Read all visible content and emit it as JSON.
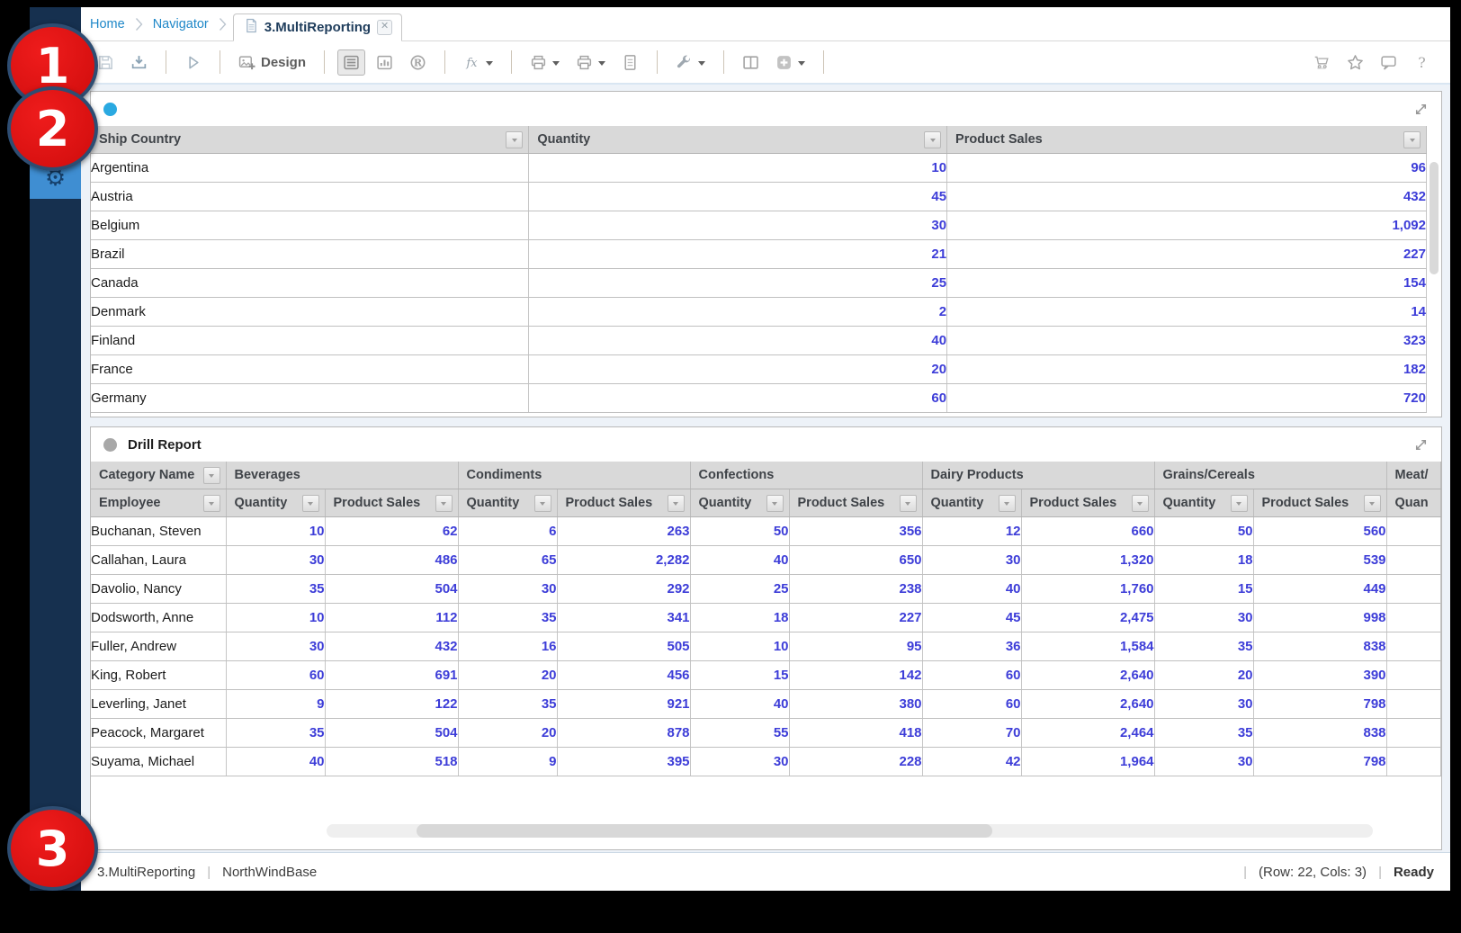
{
  "window": {
    "breadcrumbs": [
      "Home",
      "Navigator"
    ],
    "tab": {
      "label": "3.MultiReporting"
    }
  },
  "toolbar": {
    "left": [
      {
        "icon": "floppy",
        "name": "save",
        "disabled": true
      },
      {
        "icon": "export",
        "name": "export"
      },
      {
        "sep": true
      },
      {
        "icon": "run",
        "name": "run"
      },
      {
        "sep": true
      },
      {
        "icon": "design",
        "name": "design",
        "label": "Design"
      },
      {
        "sep": true
      },
      {
        "icon": "parameters",
        "name": "parameters-panel",
        "selected": true
      },
      {
        "icon": "chart",
        "name": "chart-view"
      },
      {
        "icon": "r-viewer",
        "name": "report-viewer"
      },
      {
        "sep": true
      },
      {
        "icon": "fx",
        "name": "functions",
        "caret": true
      },
      {
        "sep": true
      },
      {
        "icon": "print",
        "name": "print",
        "caret": true
      },
      {
        "icon": "print",
        "name": "print-export",
        "caret": true
      },
      {
        "icon": "page",
        "name": "page-setup"
      },
      {
        "sep": true
      },
      {
        "icon": "wrench",
        "name": "tools",
        "caret": true
      },
      {
        "sep": true
      },
      {
        "icon": "columns",
        "name": "split-view"
      },
      {
        "icon": "add",
        "name": "add-panel",
        "caret": true
      },
      {
        "sep": true
      }
    ],
    "right": [
      {
        "icon": "cart",
        "name": "cart"
      },
      {
        "icon": "star",
        "name": "favorites"
      },
      {
        "icon": "comment",
        "name": "feedback"
      },
      {
        "icon": "help",
        "name": "help"
      }
    ]
  },
  "panel1": {
    "columns": [
      "Ship Country",
      "Quantity",
      "Product Sales"
    ],
    "rows": [
      [
        "Argentina",
        "10",
        "96"
      ],
      [
        "Austria",
        "45",
        "432"
      ],
      [
        "Belgium",
        "30",
        "1,092"
      ],
      [
        "Brazil",
        "21",
        "227"
      ],
      [
        "Canada",
        "25",
        "154"
      ],
      [
        "Denmark",
        "2",
        "14"
      ],
      [
        "Finland",
        "40",
        "323"
      ],
      [
        "France",
        "20",
        "182"
      ],
      [
        "Germany",
        "60",
        "720"
      ]
    ]
  },
  "panel2": {
    "title": "Drill Report",
    "corner_header": "Category Name",
    "row_header": "Employee",
    "categories": [
      "Beverages",
      "Condiments",
      "Confections",
      "Dairy Products",
      "Grains/Cereals",
      "Meat/"
    ],
    "subcolumns": [
      "Quantity",
      "Product Sales"
    ],
    "truncated_subcolumn": "Quan",
    "rows": [
      {
        "employee": "Buchanan, Steven",
        "values": [
          "10",
          "62",
          "6",
          "263",
          "50",
          "356",
          "12",
          "660",
          "50",
          "560"
        ]
      },
      {
        "employee": "Callahan, Laura",
        "values": [
          "30",
          "486",
          "65",
          "2,282",
          "40",
          "650",
          "30",
          "1,320",
          "18",
          "539"
        ]
      },
      {
        "employee": "Davolio, Nancy",
        "values": [
          "35",
          "504",
          "30",
          "292",
          "25",
          "238",
          "40",
          "1,760",
          "15",
          "449"
        ]
      },
      {
        "employee": "Dodsworth, Anne",
        "values": [
          "10",
          "112",
          "35",
          "341",
          "18",
          "227",
          "45",
          "2,475",
          "30",
          "998"
        ]
      },
      {
        "employee": "Fuller, Andrew",
        "values": [
          "30",
          "432",
          "16",
          "505",
          "10",
          "95",
          "36",
          "1,584",
          "35",
          "838"
        ]
      },
      {
        "employee": "King, Robert",
        "values": [
          "60",
          "691",
          "20",
          "456",
          "15",
          "142",
          "60",
          "2,640",
          "20",
          "390"
        ]
      },
      {
        "employee": "Leverling, Janet",
        "values": [
          "9",
          "122",
          "35",
          "921",
          "40",
          "380",
          "60",
          "2,640",
          "30",
          "798"
        ]
      },
      {
        "employee": "Peacock, Margaret",
        "values": [
          "35",
          "504",
          "20",
          "878",
          "55",
          "418",
          "70",
          "2,464",
          "35",
          "838"
        ]
      },
      {
        "employee": "Suyama, Michael",
        "values": [
          "40",
          "518",
          "9",
          "395",
          "30",
          "228",
          "42",
          "1,964",
          "30",
          "798"
        ]
      }
    ]
  },
  "status": {
    "report_name": "3.MultiReporting",
    "database": "NorthWindBase",
    "position": "(Row: 22, Cols: 3)",
    "state": "Ready"
  },
  "callouts": {
    "items": [
      "1",
      "2",
      "3"
    ]
  },
  "colors": {
    "link_blue": "#1e87c8",
    "number_blue": "#3d3dd8",
    "panel1_bullet": "#2aa9e1",
    "panel2_bullet": "#a8a8a8",
    "sidebar_navy": "#16304f",
    "gear_tile_blue": "#3f8ed2",
    "callout_red": "#d81010"
  }
}
